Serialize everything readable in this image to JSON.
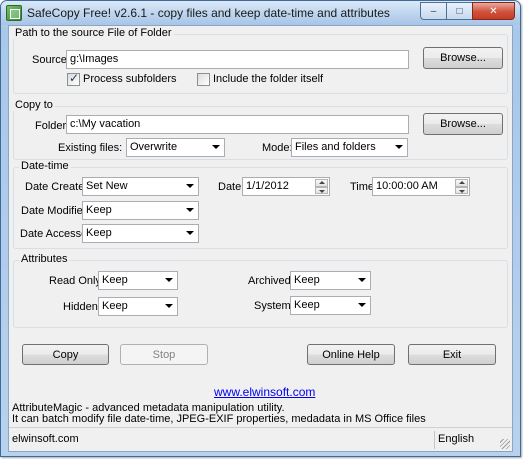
{
  "window": {
    "title": "SafeCopy Free! v2.6.1 - copy files and keep date-time and attributes"
  },
  "caption": {
    "minimize": "–",
    "maximize": "□",
    "close": "✕"
  },
  "source_group": {
    "title": "Path to the source File of Folder",
    "source_label": "Source:",
    "source_value": "g:\\Images",
    "browse_label": "Browse...",
    "process_subfolders_label": "Process subfolders",
    "process_subfolders_checked": true,
    "include_folder_label": "Include the folder itself",
    "include_folder_checked": false
  },
  "copy_group": {
    "title": "Copy to",
    "folder_label": "Folder:",
    "folder_value": "c:\\My vacation",
    "browse_label": "Browse...",
    "existing_label": "Existing files:",
    "existing_value": "Overwrite",
    "mode_label": "Mode:",
    "mode_value": "Files and folders"
  },
  "datetime_group": {
    "title": "Date-time",
    "created_label": "Date Created:",
    "created_value": "Set New",
    "date_label": "Date:",
    "date_value": "1/1/2012",
    "time_label": "Time:",
    "time_value": "10:00:00 AM",
    "modified_label": "Date Modified:",
    "modified_value": "Keep",
    "accessed_label": "Date Accessed:",
    "accessed_value": "Keep"
  },
  "attributes_group": {
    "title": "Attributes",
    "readonly_label": "Read Only:",
    "readonly_value": "Keep",
    "archived_label": "Archived:",
    "archived_value": "Keep",
    "hidden_label": "Hidden:",
    "hidden_value": "Keep",
    "system_label": "System:",
    "system_value": "Keep"
  },
  "actions": {
    "copy": "Copy",
    "stop": "Stop",
    "online_help": "Online Help",
    "exit": "Exit"
  },
  "promo": {
    "link": "www.elwinsoft.com",
    "line1": "AttributeMagic - advanced metadata manipulation utility.",
    "line2": "It can batch modify file date-time, JPEG-EXIF properties, medadata in MS Office files"
  },
  "statusbar": {
    "left": "elwinsoft.com",
    "language": "English"
  }
}
